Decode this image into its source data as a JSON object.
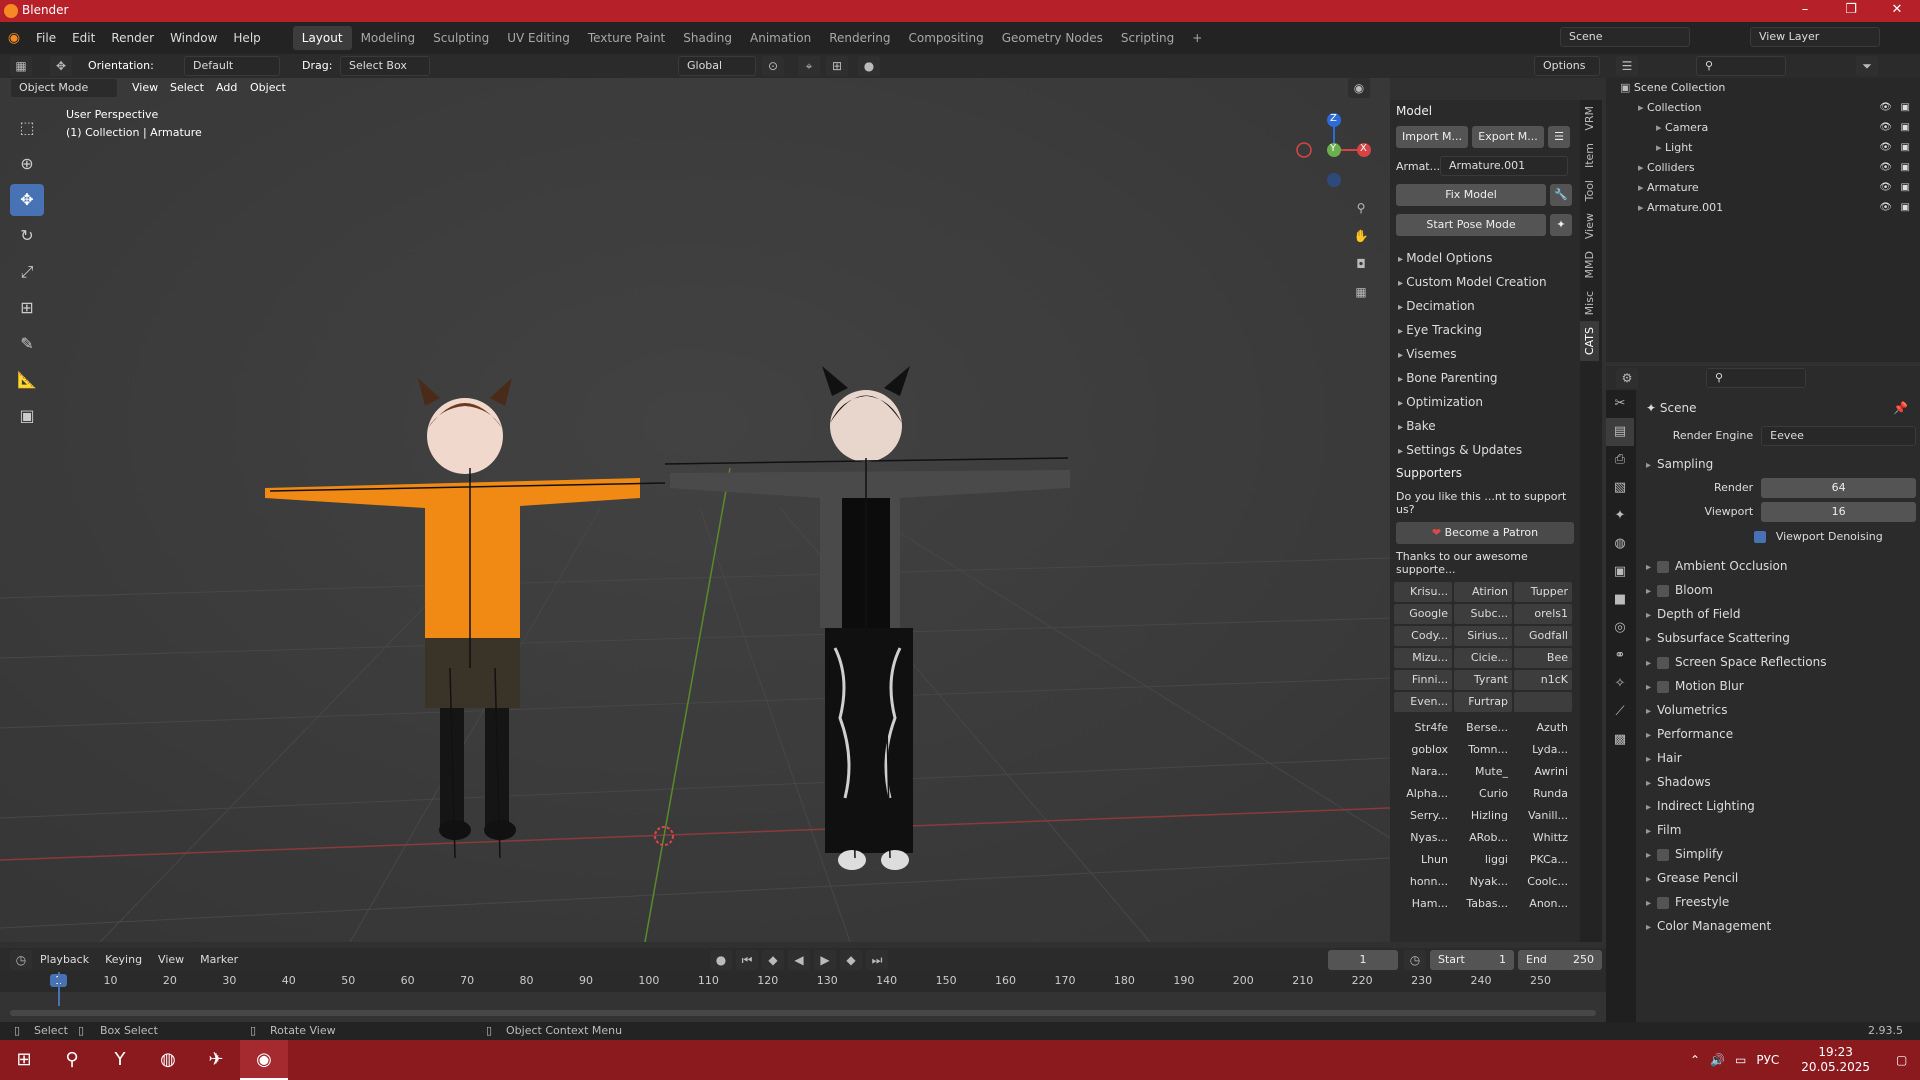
{
  "window": {
    "title": "Blender",
    "min": "–",
    "max": "❐",
    "close": "✕"
  },
  "menubar": {
    "menus": [
      "File",
      "Edit",
      "Render",
      "Window",
      "Help"
    ],
    "workspaces": [
      "Layout",
      "Modeling",
      "Sculpting",
      "UV Editing",
      "Texture Paint",
      "Shading",
      "Animation",
      "Rendering",
      "Compositing",
      "Geometry Nodes",
      "Scripting"
    ],
    "add_ws": "+",
    "scene": "Scene",
    "view_layer": "View Layer"
  },
  "viewport_header": {
    "orientation_label": "Orientation:",
    "orientation_value": "Default",
    "drag_label": "Drag:",
    "drag_value": "Select Box",
    "transform": "Global",
    "options": "Options",
    "mode": "Object Mode",
    "menus": [
      "View",
      "Select",
      "Add",
      "Object"
    ]
  },
  "viewport": {
    "perspective": "User Perspective",
    "collection": "(1) Collection | Armature",
    "gizmo": {
      "x": "X",
      "y": "Y",
      "z": "Z"
    }
  },
  "npanel": {
    "model_head": "Model",
    "import": "Import M...",
    "export": "Export M...",
    "armature_label": "Armat...",
    "armature_value": "Armature.001",
    "fix_model": "Fix Model",
    "start_pose": "Start Pose Mode",
    "sections": [
      "Model Options",
      "Custom Model Creation",
      "Decimation",
      "Eye Tracking",
      "Visemes",
      "Bone Parenting",
      "Optimization",
      "Bake",
      "Settings & Updates"
    ],
    "supporters_head": "Supporters",
    "support_q": "Do you like this ...nt to support us?",
    "patron": "Become a Patron",
    "thanks": "Thanks to our awesome supporte...",
    "supporters_a": [
      "Krisu...",
      "Atirion",
      "Tupper",
      "Google",
      "Subc...",
      "orels1",
      "Cody...",
      "Sirius...",
      "Godfall",
      "Mizu...",
      "Cicie...",
      "Bee",
      "Finni...",
      "Tyrant",
      "n1cK",
      "Even...",
      "Furtrap",
      ""
    ],
    "supporters_b": [
      "Str4fe",
      "Berse...",
      "Azuth",
      "goblox",
      "Tomn...",
      "Lyda...",
      "Nara...",
      "Mute_",
      "Awrini",
      "Alpha...",
      "Curio",
      "Runda",
      "Serry...",
      "Hizling",
      "Vanill...",
      "Nyas...",
      "ARob...",
      "Whittz",
      "Lhun",
      "liggi",
      "PKCa...",
      "honn...",
      "Nyak...",
      "Coolc...",
      "Ham...",
      "Tabas...",
      "Anon..."
    ],
    "tabs": [
      "VRM",
      "Item",
      "Tool",
      "View",
      "MMD",
      "Misc",
      "CATS"
    ]
  },
  "outliner": {
    "root": "Scene Collection",
    "rows": [
      {
        "name": "Collection",
        "indent": 1
      },
      {
        "name": "Camera",
        "indent": 2
      },
      {
        "name": "Light",
        "indent": 2
      },
      {
        "name": "Colliders",
        "indent": 1
      },
      {
        "name": "Armature",
        "indent": 1
      },
      {
        "name": "Armature.001",
        "indent": 1
      }
    ]
  },
  "properties": {
    "scene": "Scene",
    "render_engine_label": "Render Engine",
    "render_engine": "Eevee",
    "sampling": "Sampling",
    "render_label": "Render",
    "render_val": "64",
    "viewport_label": "Viewport",
    "viewport_val": "16",
    "denoise": "Viewport Denoising",
    "sections": [
      {
        "name": "Ambient Occlusion",
        "chk": true
      },
      {
        "name": "Bloom",
        "chk": true
      },
      {
        "name": "Depth of Field",
        "chk": false
      },
      {
        "name": "Subsurface Scattering",
        "chk": false
      },
      {
        "name": "Screen Space Reflections",
        "chk": true
      },
      {
        "name": "Motion Blur",
        "chk": true
      },
      {
        "name": "Volumetrics",
        "chk": false
      },
      {
        "name": "Performance",
        "chk": false
      },
      {
        "name": "Hair",
        "chk": false
      },
      {
        "name": "Shadows",
        "chk": false
      },
      {
        "name": "Indirect Lighting",
        "chk": false
      },
      {
        "name": "Film",
        "chk": false
      },
      {
        "name": "Simplify",
        "chk": true
      },
      {
        "name": "Grease Pencil",
        "chk": false
      },
      {
        "name": "Freestyle",
        "chk": true
      },
      {
        "name": "Color Management",
        "chk": false
      }
    ]
  },
  "timeline": {
    "menus": [
      "Playback",
      "Keying",
      "View",
      "Marker"
    ],
    "current": "1",
    "start_label": "Start",
    "start": "1",
    "end_label": "End",
    "end": "250",
    "ticks": [
      "1",
      "10",
      "20",
      "30",
      "40",
      "50",
      "60",
      "70",
      "80",
      "90",
      "100",
      "110",
      "120",
      "130",
      "140",
      "150",
      "160",
      "170",
      "180",
      "190",
      "200",
      "210",
      "220",
      "230",
      "240",
      "250"
    ]
  },
  "statusbar": {
    "select": "Select",
    "box": "Box Select",
    "rotate": "Rotate View",
    "context": "Object Context Menu",
    "version": "2.93.5"
  },
  "taskbar": {
    "lang": "РУС",
    "time": "19:23",
    "date": "20.05.2025"
  }
}
